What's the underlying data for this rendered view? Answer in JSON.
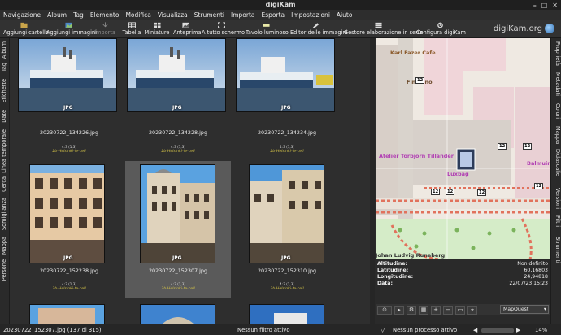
{
  "window": {
    "title": "digiKam"
  },
  "menu": [
    "Navigazione",
    "Album",
    "Tag",
    "Elemento",
    "Modifica",
    "Visualizza",
    "Strumenti",
    "Importa",
    "Esporta",
    "Impostazioni",
    "Aiuto"
  ],
  "toolbar": {
    "items": [
      "Aggiungi cartelle",
      "Aggiungi immagini",
      "Importa",
      "Tabella",
      "Miniature",
      "Anteprima",
      "A tutto schermo",
      "Tavolo luminoso",
      "Editor delle immagini",
      "Gestore elaborazione in serie",
      "Configura digiKam"
    ],
    "brand": "digiKam.org"
  },
  "left_tabs": [
    "Album",
    "Tag",
    "Etichette",
    "Date",
    "Linea temporale",
    "Cerca",
    "Somiglianza",
    "Mappa",
    "Persone"
  ],
  "right_tabs": [
    "Proprietà",
    "Metadati",
    "Colori",
    "Mappa",
    "Didascalie",
    "Versioni",
    "Filtri",
    "Strumenti"
  ],
  "thumbnails": [
    {
      "filename": "20230722_134226.jpg",
      "format": "JPG",
      "rating": "",
      "tag": ""
    },
    {
      "filename": "20230722_134228.jpg",
      "format": "JPG",
      "rating": "",
      "tag": ""
    },
    {
      "filename": "20230722_134234.jpg",
      "format": "JPG",
      "rating": "",
      "tag": ""
    },
    {
      "filename": "20230722_152238.jpg",
      "format": "JPG",
      "rating": "4:3 (1,3)",
      "tag": "2b-Helsinki-fe-cell"
    },
    {
      "filename": "20230722_152307.jpg",
      "format": "JPG",
      "rating": "4:3 (1,3)",
      "tag": "2b-Helsinki-fe-cell"
    },
    {
      "filename": "20230722_152310.jpg",
      "format": "JPG",
      "rating": "4:3 (1,3)",
      "tag": "2b-Helsinki-fe-cell"
    }
  ],
  "row1_meta": {
    "rating": "4:3 (1,3)",
    "tag": "2b-Helsinki-fe-cell"
  },
  "map": {
    "labels": [
      "Karl Fazer Cafe",
      "Finnkino",
      "Atelier Torbjörn Tillander",
      "Luxbag",
      "Balmuir",
      "Johan Ludvig Runeberg"
    ],
    "house_number": "12",
    "info": {
      "altitude_label": "Altitudine:",
      "altitude_value": "Non definito",
      "latitude_label": "Latitudine:",
      "latitude_value": "60,16803",
      "longitude_label": "Longitudine:",
      "longitude_value": "24,94818",
      "date_label": "Data:",
      "date_value": "22/07/23 15:23"
    },
    "provider": "MapQuest"
  },
  "status": {
    "current_item": "20230722_152307.jpg (137 di 315)",
    "filter": "Nessun filtro attivo",
    "process": "Nessun processo attivo",
    "zoom": "14%"
  }
}
